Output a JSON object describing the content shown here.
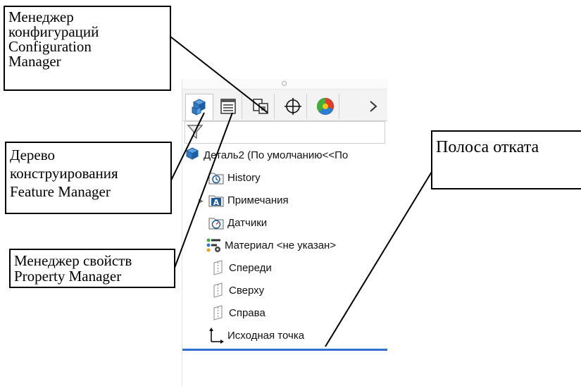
{
  "callouts": {
    "config_manager": [
      "Менеджер",
      "конфигураций",
      "Configuration",
      "Manager"
    ],
    "feature_manager": [
      "Дерево",
      "конструирования",
      "Feature Manager"
    ],
    "property_manager": [
      "Менеджер свойств",
      "Property Manager"
    ],
    "rollback_bar": [
      "Полоса отката"
    ]
  },
  "tabs": [
    {
      "name": "FeatureManager",
      "icon": "feature-tree-icon",
      "active": true
    },
    {
      "name": "PropertyManager",
      "icon": "property-manager-icon"
    },
    {
      "name": "ConfigurationManager",
      "icon": "configuration-manager-icon"
    },
    {
      "name": "DimXpertManager",
      "icon": "crosshair-icon"
    },
    {
      "name": "DisplayManager",
      "icon": "display-manager-icon"
    },
    {
      "name": "More",
      "icon": "chevron-right-icon"
    }
  ],
  "tree": {
    "root": "Деталь2  (По умолчанию<<По",
    "items": [
      {
        "label": "History",
        "icon": "history-icon"
      },
      {
        "label": "Примечания",
        "icon": "annotations-icon",
        "expandable": true
      },
      {
        "label": "Датчики",
        "icon": "sensors-icon"
      },
      {
        "label": "Материал <не указан>",
        "icon": "material-icon"
      },
      {
        "label": "Спереди",
        "icon": "plane-icon"
      },
      {
        "label": "Сверху",
        "icon": "plane-icon"
      },
      {
        "label": "Справа",
        "icon": "plane-icon"
      },
      {
        "label": "Исходная точка",
        "icon": "origin-icon"
      }
    ]
  },
  "colors": {
    "rollback": "#2e6fd1",
    "tab_bg": "#f3f3f3"
  }
}
